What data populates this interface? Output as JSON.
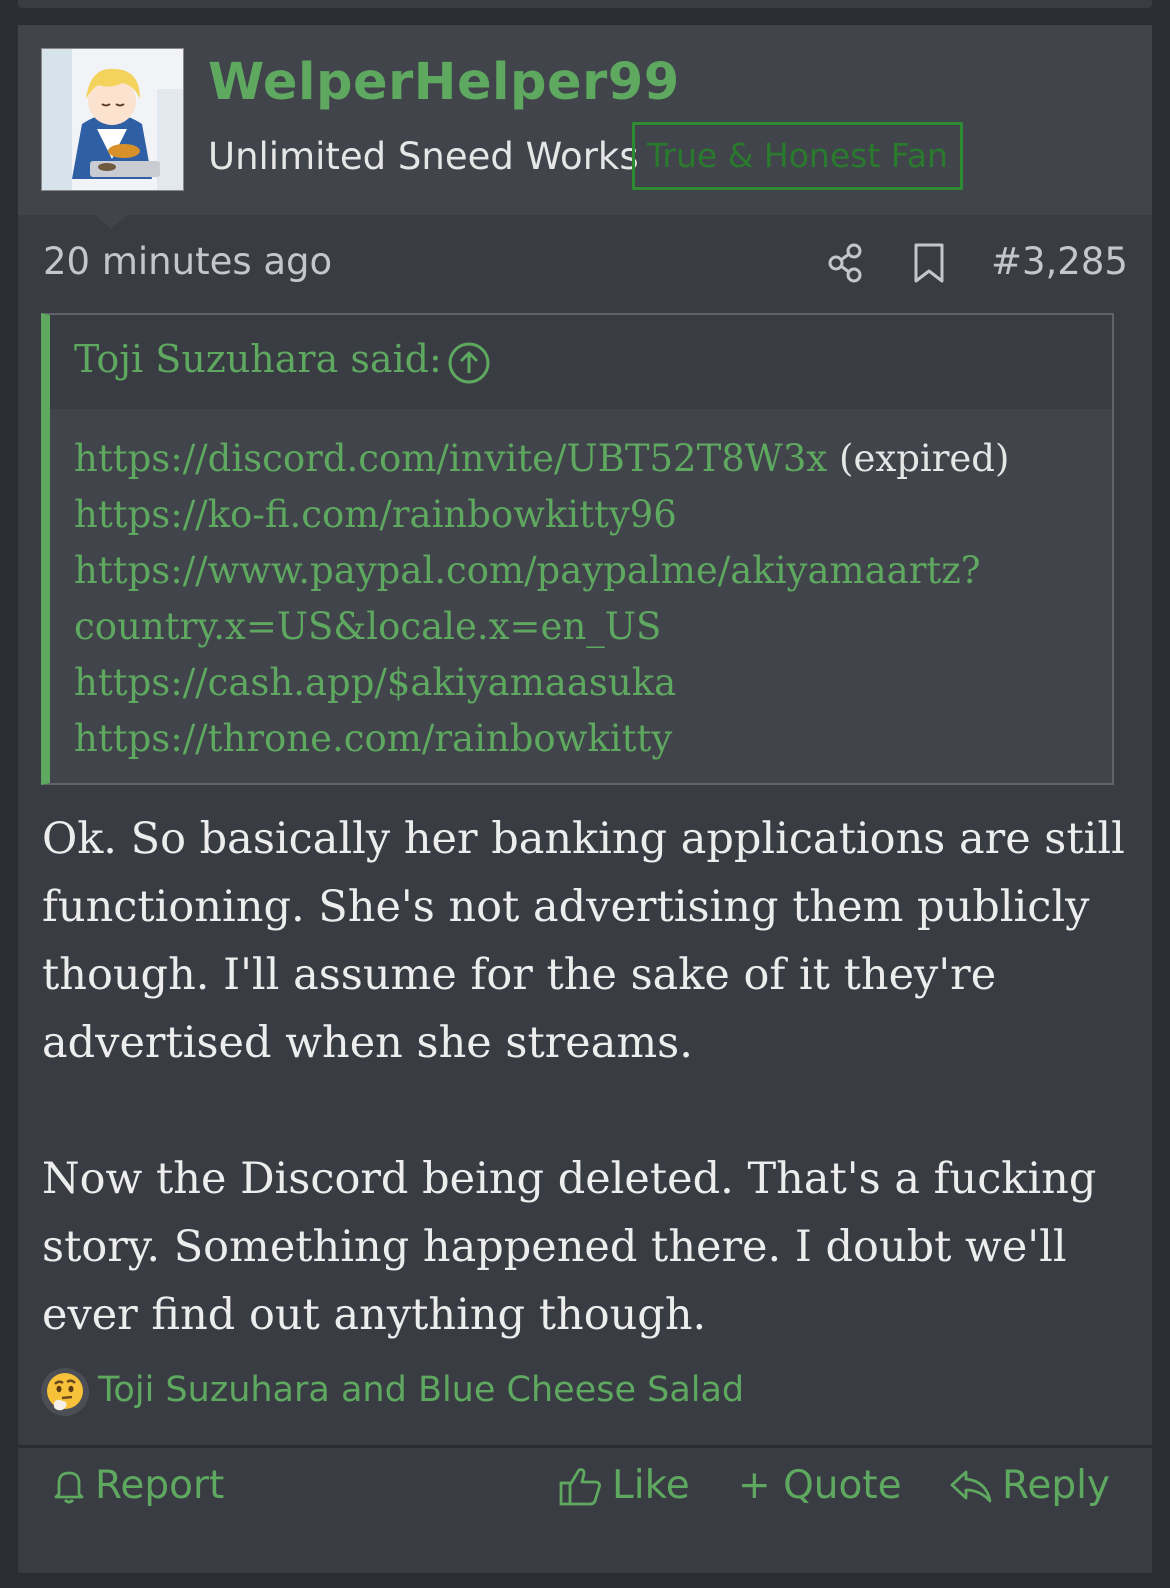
{
  "user": {
    "name": "WelperHelper99",
    "title": "Unlimited Sneed Works",
    "banner": "True & Honest Fan"
  },
  "meta": {
    "time": "20 minutes ago",
    "post_number": "#3,285"
  },
  "quote": {
    "author_line": "Toji Suzuhara said:",
    "lines": [
      {
        "link": "https://discord.com/invite/UBT52T8W3x",
        "suffix": " (expired)"
      },
      {
        "link": "https://ko-fi.com/rainbowkitty96",
        "suffix": ""
      },
      {
        "link": "https://www.paypal.com/paypalme/akiyamaartz?",
        "suffix": ""
      },
      {
        "link": "country.x=US&locale.x=en_US",
        "suffix": ""
      },
      {
        "link": "https://cash.app/$akiyamaasuka",
        "suffix": ""
      },
      {
        "link": "https://throne.com/rainbowkitty",
        "suffix": ""
      }
    ]
  },
  "body": {
    "paragraph1": "Ok. So basically her banking applications are still functioning. She's not advertising them publicly though. I'll assume for the sake of it they're advertised when she streams.",
    "paragraph2": "Now the Discord being deleted. That's a fucking story. Something happened there. I doubt we'll ever find out anything though."
  },
  "reactions": {
    "emoji": "thinking-face-icon",
    "names": "Toji Suzuhara and Blue Cheese Salad"
  },
  "actions": {
    "report": "Report",
    "like": "Like",
    "quote": "+ Quote",
    "reply": "Reply"
  },
  "colors": {
    "accent": "#5ea860",
    "banner_border": "#2e8b32",
    "post_bg": "#393c43",
    "header_bg": "#41444b",
    "page_bg": "#2a2d33"
  }
}
